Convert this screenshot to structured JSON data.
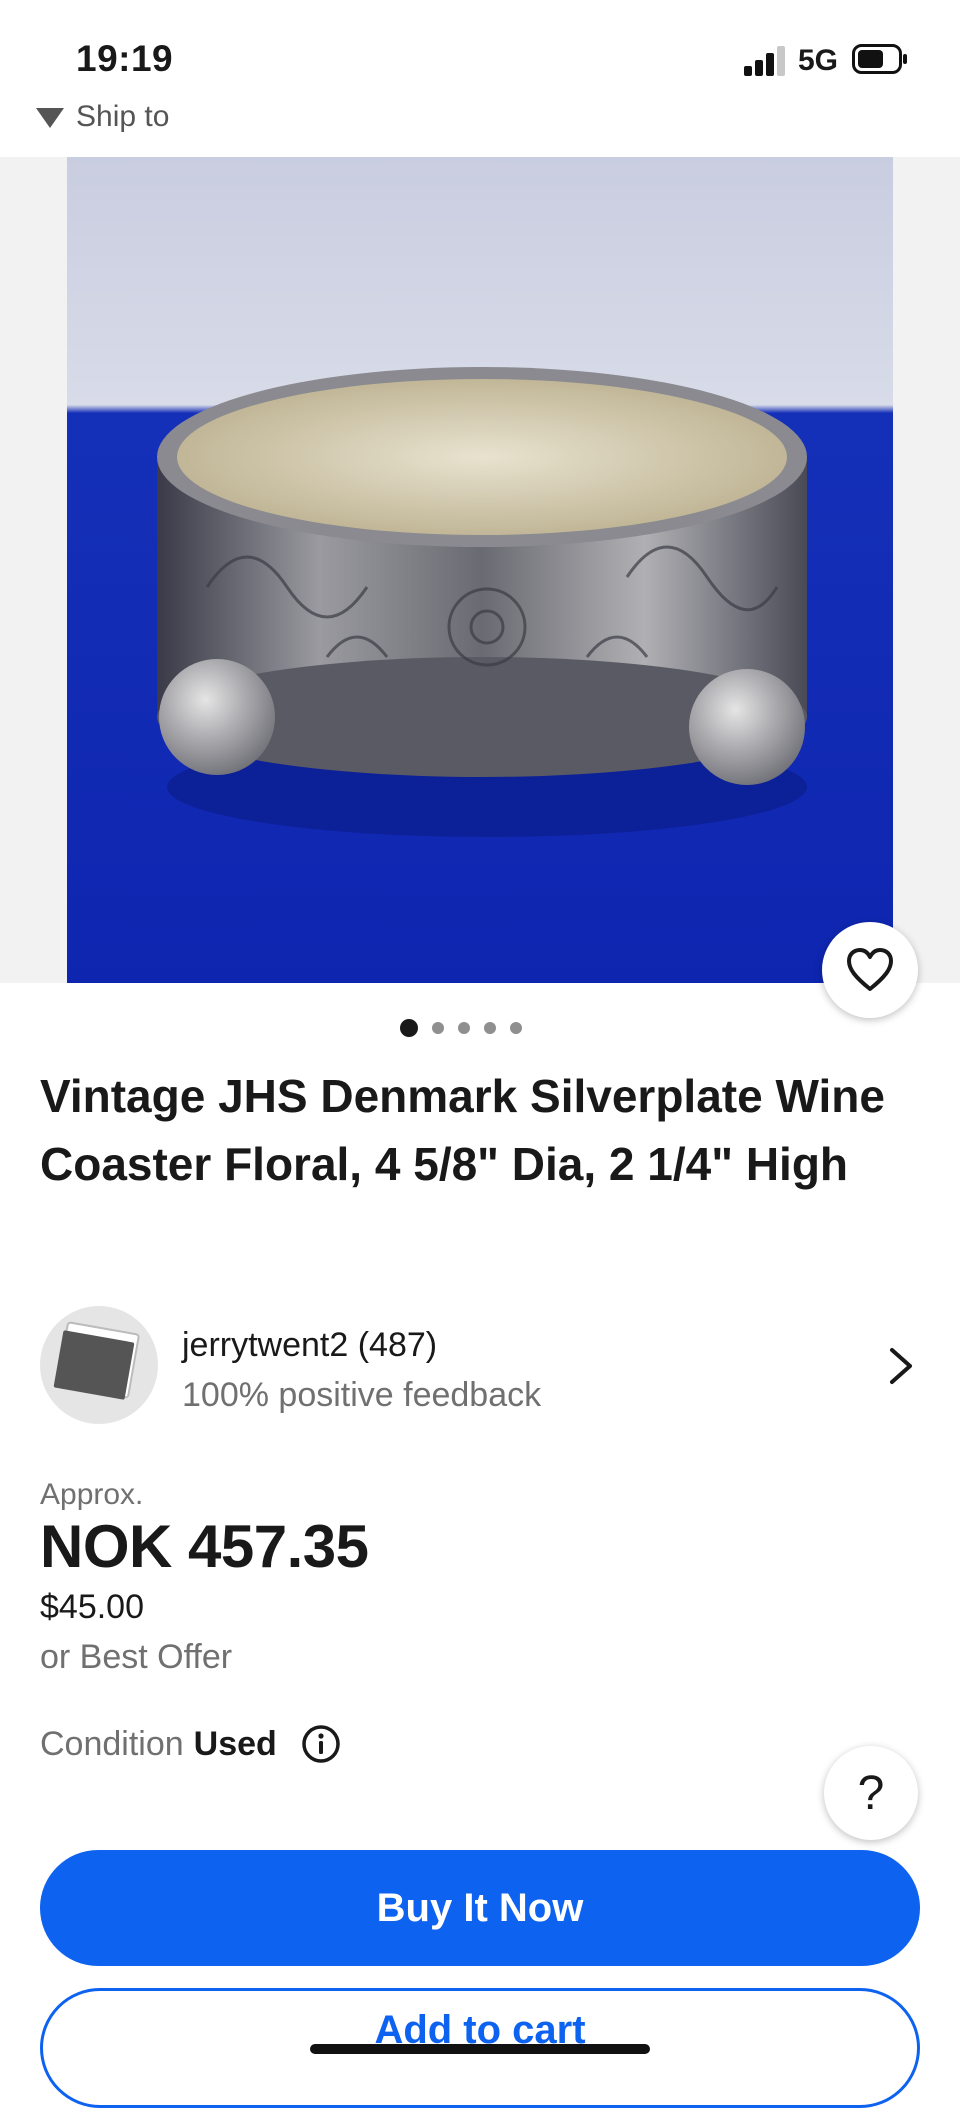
{
  "status_bar": {
    "time": "19:19",
    "network": "5G"
  },
  "header": {
    "ship_to_label": "Ship to"
  },
  "gallery": {
    "image_count": 5,
    "active_index": 0
  },
  "listing": {
    "title": "Vintage JHS Denmark Silverplate Wine Coaster Floral, 4 5/8\" Dia, 2 1/4\" High"
  },
  "seller": {
    "name": "jerrytwent2 (487)",
    "feedback": "100% positive feedback"
  },
  "pricing": {
    "approx_label": "Approx.",
    "converted_price": "NOK 457.35",
    "original_price": "$45.00",
    "best_offer": "or Best Offer"
  },
  "condition": {
    "label": "Condition",
    "value": "Used"
  },
  "help": {
    "label": "?"
  },
  "actions": {
    "buy_now": "Buy It Now",
    "add_to_cart": "Add to cart"
  },
  "colors": {
    "primary_blue": "#0d63f0",
    "text": "#191919",
    "muted": "#707070"
  }
}
